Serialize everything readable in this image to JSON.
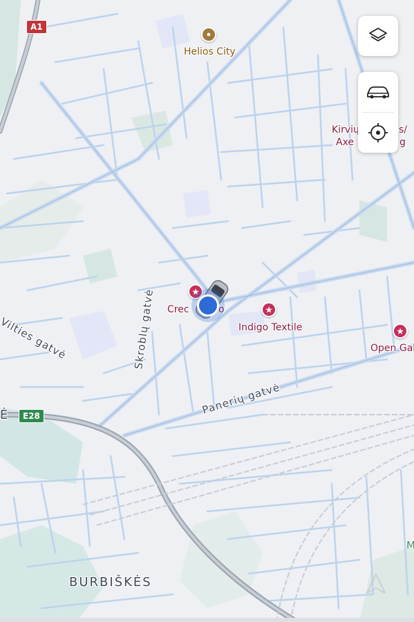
{
  "map": {
    "background": "#eef0f3",
    "road_color": "#b9d1ec",
    "major_road_color": "#c8d9ee",
    "highway_color": "#9aa3ad",
    "water_color": "#cfe3e4",
    "park_color": "#dde9e3",
    "building_color": "#e2e5f7"
  },
  "streets": {
    "paneriu": "Panerių gatvė",
    "skrobly": "Skroblų gatvė",
    "vilties": "Vilties gatvė"
  },
  "districts": {
    "burbiskes": "BURBIŠKĖS",
    "edge_left": "Ė"
  },
  "places": {
    "helios": "Helios City"
  },
  "pois": {
    "indigo": "Indigo Textile",
    "crec": "Crec",
    "crec_tail": "o",
    "open_gal": "Open Gal",
    "kirviu_line1": "Kirvių",
    "kirviu_line1_tail": "s/",
    "kirviu_line2": "Axe",
    "kirviu_line2_tail": "g"
  },
  "shields": {
    "a1": "A1",
    "e28": "E28",
    "a1_color": "#c0343b",
    "e28_color": "#2e8b4f"
  },
  "poi_color": "#c4305b",
  "controls": {
    "layers_icon": "layers-icon",
    "vehicle_icon": "car-icon",
    "locate_icon": "crosshair-icon"
  },
  "location_color": "#2f6bd6",
  "watermark_left": "M"
}
